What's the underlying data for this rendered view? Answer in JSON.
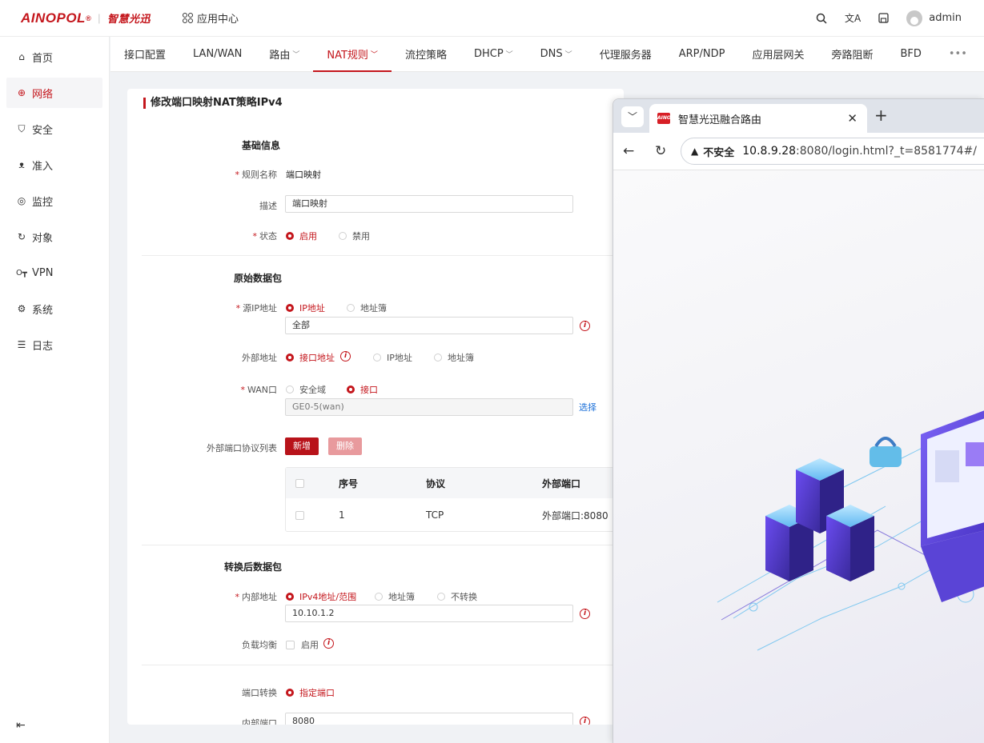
{
  "brand": {
    "logo": "AINOPOL",
    "reg": "®",
    "sep": "|",
    "name_cn": "智慧光迅"
  },
  "topbar": {
    "app_center": "应用中心",
    "user": "admin"
  },
  "sidebar": {
    "items": [
      {
        "label": "首页",
        "icon": "home-icon"
      },
      {
        "label": "网络",
        "icon": "globe-icon",
        "active": true
      },
      {
        "label": "安全",
        "icon": "shield-icon"
      },
      {
        "label": "准入",
        "icon": "users-icon"
      },
      {
        "label": "监控",
        "icon": "monitor-icon"
      },
      {
        "label": "对象",
        "icon": "object-icon"
      },
      {
        "label": "VPN",
        "icon": "key-icon"
      },
      {
        "label": "系统",
        "icon": "settings-icon"
      },
      {
        "label": "日志",
        "icon": "list-icon"
      }
    ]
  },
  "tabs": [
    {
      "label": "接口配置"
    },
    {
      "label": "LAN/WAN"
    },
    {
      "label": "路由",
      "dropdown": true
    },
    {
      "label": "NAT规则",
      "dropdown": true,
      "active": true
    },
    {
      "label": "流控策略"
    },
    {
      "label": "DHCP",
      "dropdown": true
    },
    {
      "label": "DNS",
      "dropdown": true
    },
    {
      "label": "代理服务器"
    },
    {
      "label": "ARP/NDP"
    },
    {
      "label": "应用层网关"
    },
    {
      "label": "旁路阻断"
    },
    {
      "label": "BFD"
    },
    {
      "label": "•••"
    }
  ],
  "form": {
    "title": "修改端口映射NAT策略IPv4",
    "basic": {
      "section": "基础信息",
      "rule_name_label": "规则名称",
      "rule_name_value": "端口映射",
      "desc_label": "描述",
      "desc_value": "端口映射",
      "status_label": "状态",
      "status_on": "启用",
      "status_off": "禁用"
    },
    "original": {
      "section": "原始数据包",
      "src_ip_label": "源IP地址",
      "src_opt_ip": "IP地址",
      "src_opt_pool": "地址簿",
      "src_value": "全部",
      "ext_addr_label": "外部地址",
      "ext_opt_iface": "接口地址",
      "ext_opt_ip": "IP地址",
      "ext_opt_pool": "地址簿",
      "wan_label": "WAN口",
      "wan_opt_zone": "安全域",
      "wan_opt_iface": "接口",
      "wan_value": "GE0-5(wan)",
      "wan_select": "选择",
      "port_list_label": "外部端口协议列表",
      "add_btn": "新增",
      "del_btn": "删除",
      "table": {
        "headers": [
          "序号",
          "协议",
          "外部端口"
        ],
        "rows": [
          [
            "1",
            "TCP",
            "外部端口:8080"
          ]
        ]
      }
    },
    "translated": {
      "section": "转换后数据包",
      "inner_addr_label": "内部地址",
      "opt_range": "IPv4地址/范围",
      "opt_pool": "地址簿",
      "opt_none": "不转换",
      "inner_addr_value": "10.10.1.2",
      "lb_label": "负载均衡",
      "lb_enable": "启用",
      "port_trans_label": "端口转换",
      "port_trans_opt": "指定端口",
      "inner_port_label": "内部端口",
      "inner_port_value": "8080"
    }
  },
  "browser": {
    "tab_title": "智慧光迅融合路由",
    "favicon_text": "AINO",
    "insecure_label": "不安全",
    "url_host": "10.8.9.28",
    "url_rest": ":8080/login.html?_t=8581774#/"
  },
  "colors": {
    "accent": "#c4161c",
    "link": "#1a6fd8"
  }
}
